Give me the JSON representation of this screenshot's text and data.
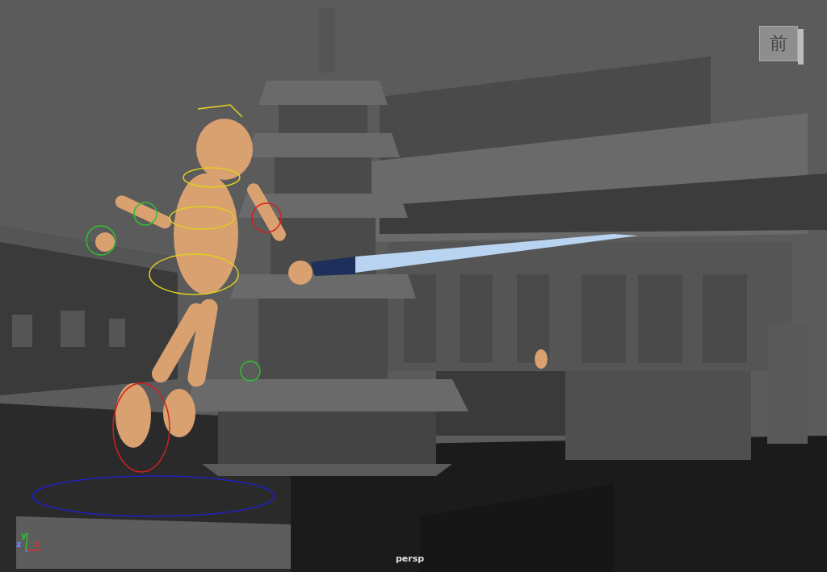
{
  "viewport": {
    "camera": "persp",
    "view_cube": {
      "face": "前"
    },
    "axes": [
      {
        "label": "x",
        "color": "#e03030"
      },
      {
        "label": "y",
        "color": "#30c030"
      },
      {
        "label": "z",
        "color": "#6a88ff"
      }
    ]
  }
}
